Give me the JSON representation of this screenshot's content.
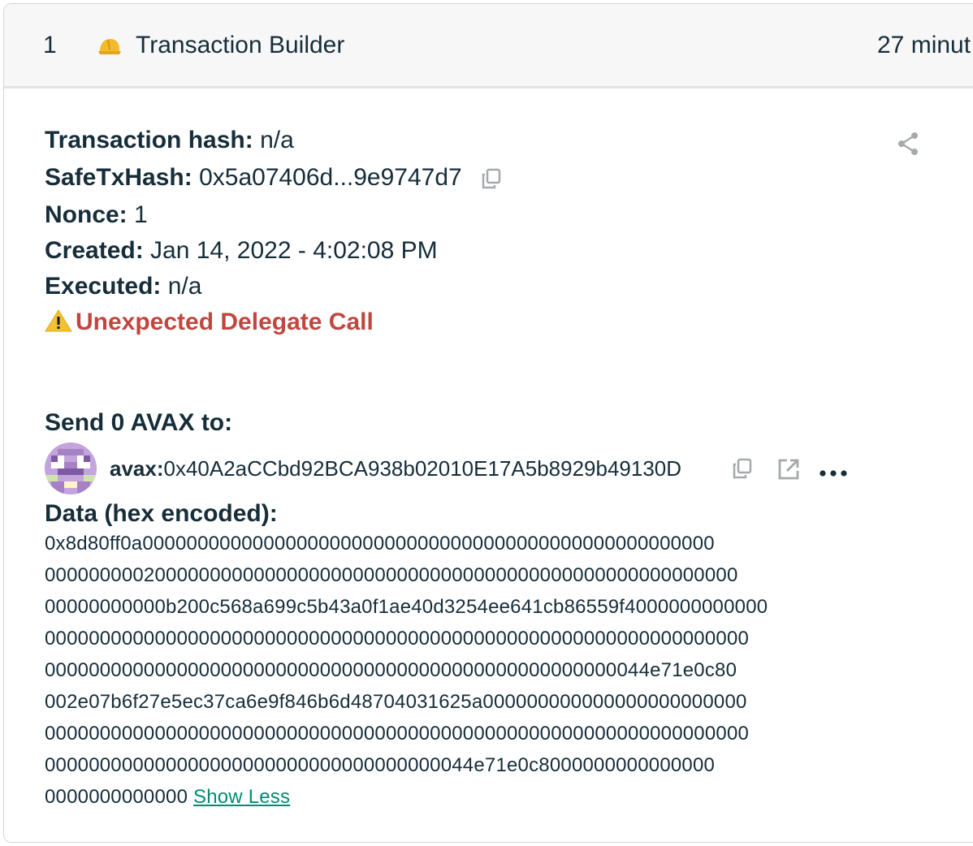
{
  "header": {
    "nonce": "1",
    "title": "Transaction Builder",
    "time": "27 minut",
    "icon": "transaction-builder-helmet-icon"
  },
  "details": {
    "tx_hash_label": "Transaction hash:",
    "tx_hash_value": "n/a",
    "safe_tx_hash_label": "SafeTxHash:",
    "safe_tx_hash_value": "0x5a07406d...9e9747d7",
    "nonce_label": "Nonce:",
    "nonce_value": "1",
    "created_label": "Created:",
    "created_value": "Jan 14, 2022 - 4:02:08 PM",
    "executed_label": "Executed:",
    "executed_value": "n/a",
    "warning": "Unexpected Delegate Call"
  },
  "send": {
    "title": "Send 0 AVAX to:",
    "address_prefix": "avax:",
    "address": "0x40A2aCCbd92BCA938b02010E17A5b8929b49130D"
  },
  "data": {
    "title": "Data (hex encoded):",
    "lines": [
      "0x8d80ff0a0000000000000000000000000000000000000000000000000000",
      "000000000200000000000000000000000000000000000000000000000000000",
      "00000000000b200c568a699c5b43a0f1ae40d3254ee641cb86559f4000000000000",
      "0000000000000000000000000000000000000000000000000000000000000000",
      "0000000000000000000000000000000000000000000000000000044e71e0c80",
      "002e07b6f27e5ec37ca6e9f846b6d48704031625a000000000000000000000000",
      "0000000000000000000000000000000000000000000000000000000000000000",
      "000000000000000000000000000000000000044e71e0c8000000000000000",
      "0000000000000"
    ],
    "show_less_label": "Show Less"
  },
  "colors": {
    "text": "#162d3a",
    "warning": "#c0473f",
    "link": "#008c73",
    "header_bg": "#f7f7f7"
  },
  "icons": {
    "share": "share-icon",
    "copy": "copy-icon",
    "external": "external-link-icon",
    "more": "more-options-icon",
    "warning": "warning-triangle-icon"
  }
}
